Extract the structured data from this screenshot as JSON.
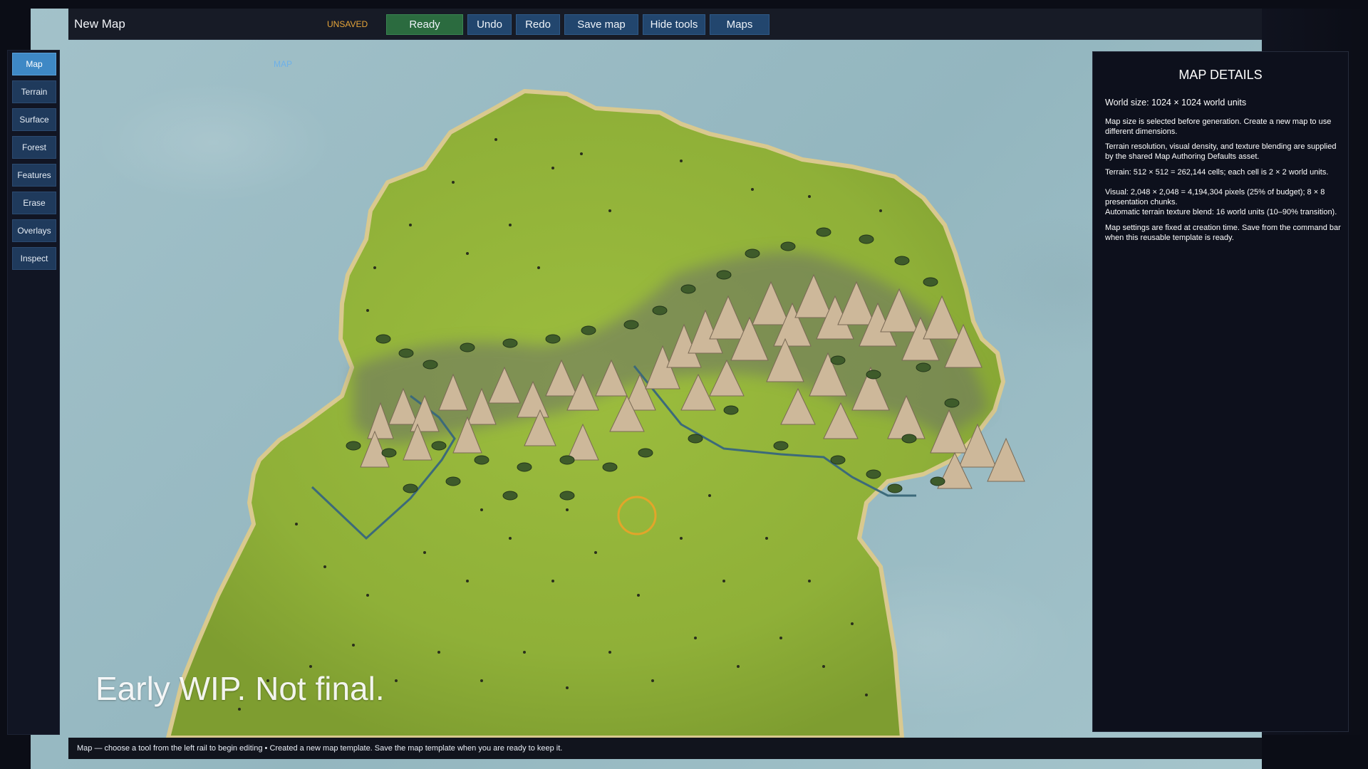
{
  "commandbar": {
    "title": "New Map",
    "mode_tag": "MAP",
    "save_state": "UNSAVED",
    "buttons": {
      "ready": "Ready",
      "undo": "Undo",
      "redo": "Redo",
      "save": "Save map",
      "hide_tools": "Hide tools",
      "maps": "Maps"
    }
  },
  "rail": {
    "items": [
      {
        "label": "Map",
        "active": true
      },
      {
        "label": "Terrain"
      },
      {
        "label": "Surface"
      },
      {
        "label": "Forest"
      },
      {
        "label": "Features"
      },
      {
        "label": "Erase"
      },
      {
        "label": "Overlays"
      },
      {
        "label": "Inspect"
      }
    ]
  },
  "details": {
    "title": "MAP DETAILS",
    "world_size": "World size: 1024 × 1024 world units",
    "lines": [
      "Map size is selected before generation. Create a new map to use different dimensions.",
      "Terrain resolution, visual density, and texture blending are supplied by the shared Map Authoring Defaults asset.",
      "Terrain: 512 × 512 = 262,144 cells; each cell is 2 × 2 world units.",
      "Visual: 2,048 × 2,048 = 4,194,304 pixels (25% of budget); 8 × 8 presentation chunks.",
      "Automatic terrain texture blend: 16 world units (10–90% transition).",
      "Map settings are fixed at creation time. Save from the command bar when this reusable template is ready."
    ]
  },
  "watermark": "Early WIP. Not final.",
  "status": {
    "text": "Map — choose a tool from the left rail to begin editing  •  Created a new map template. Save the map template when you are ready to keep it."
  },
  "colors": {
    "accent": "#3e88c5",
    "ready": "#2b6b3f",
    "unsaved": "#e6a53a",
    "grass": "#8fb23a",
    "water": "#9fc0c8",
    "river": "#3c6a7a",
    "cursor": "#e2a52a"
  }
}
